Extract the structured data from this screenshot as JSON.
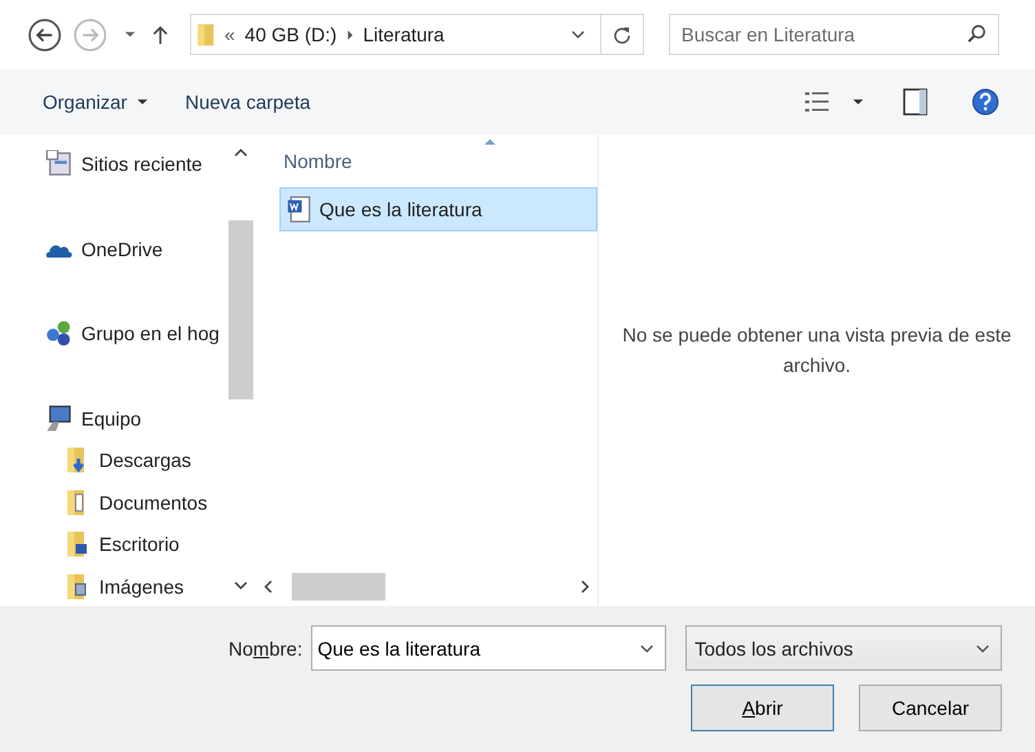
{
  "address_bar": {
    "overflow": "«",
    "path": [
      {
        "label": "40 GB (D:)"
      },
      {
        "label": "Literatura"
      }
    ]
  },
  "search": {
    "placeholder": "Buscar en Literatura"
  },
  "toolbar": {
    "organize": "Organizar",
    "new_folder": "Nueva carpeta"
  },
  "navigation": {
    "items": [
      {
        "label": "Sitios reciente",
        "kind": "recent"
      },
      {
        "label": "OneDrive",
        "kind": "cloud"
      },
      {
        "label": "Grupo en el hog",
        "kind": "homegroup"
      },
      {
        "label": "Equipo",
        "kind": "computer"
      },
      {
        "label": "Descargas",
        "kind": "downloads"
      },
      {
        "label": "Documentos",
        "kind": "documents"
      },
      {
        "label": "Escritorio",
        "kind": "desktop"
      },
      {
        "label": "Imágenes",
        "kind": "pictures"
      }
    ]
  },
  "file_list": {
    "column": "Nombre",
    "files": [
      {
        "name": "Que es la literatura",
        "selected": true
      }
    ]
  },
  "preview": {
    "message": "No se puede obtener una vista previa de este archivo."
  },
  "footer": {
    "name_label": {
      "before": "No",
      "underlined": "m",
      "after": "bre:"
    },
    "name_value": "Que es la literatura",
    "file_type": "Todos los archivos",
    "open": {
      "underlined": "A",
      "after": "brir"
    },
    "cancel": "Cancelar"
  }
}
